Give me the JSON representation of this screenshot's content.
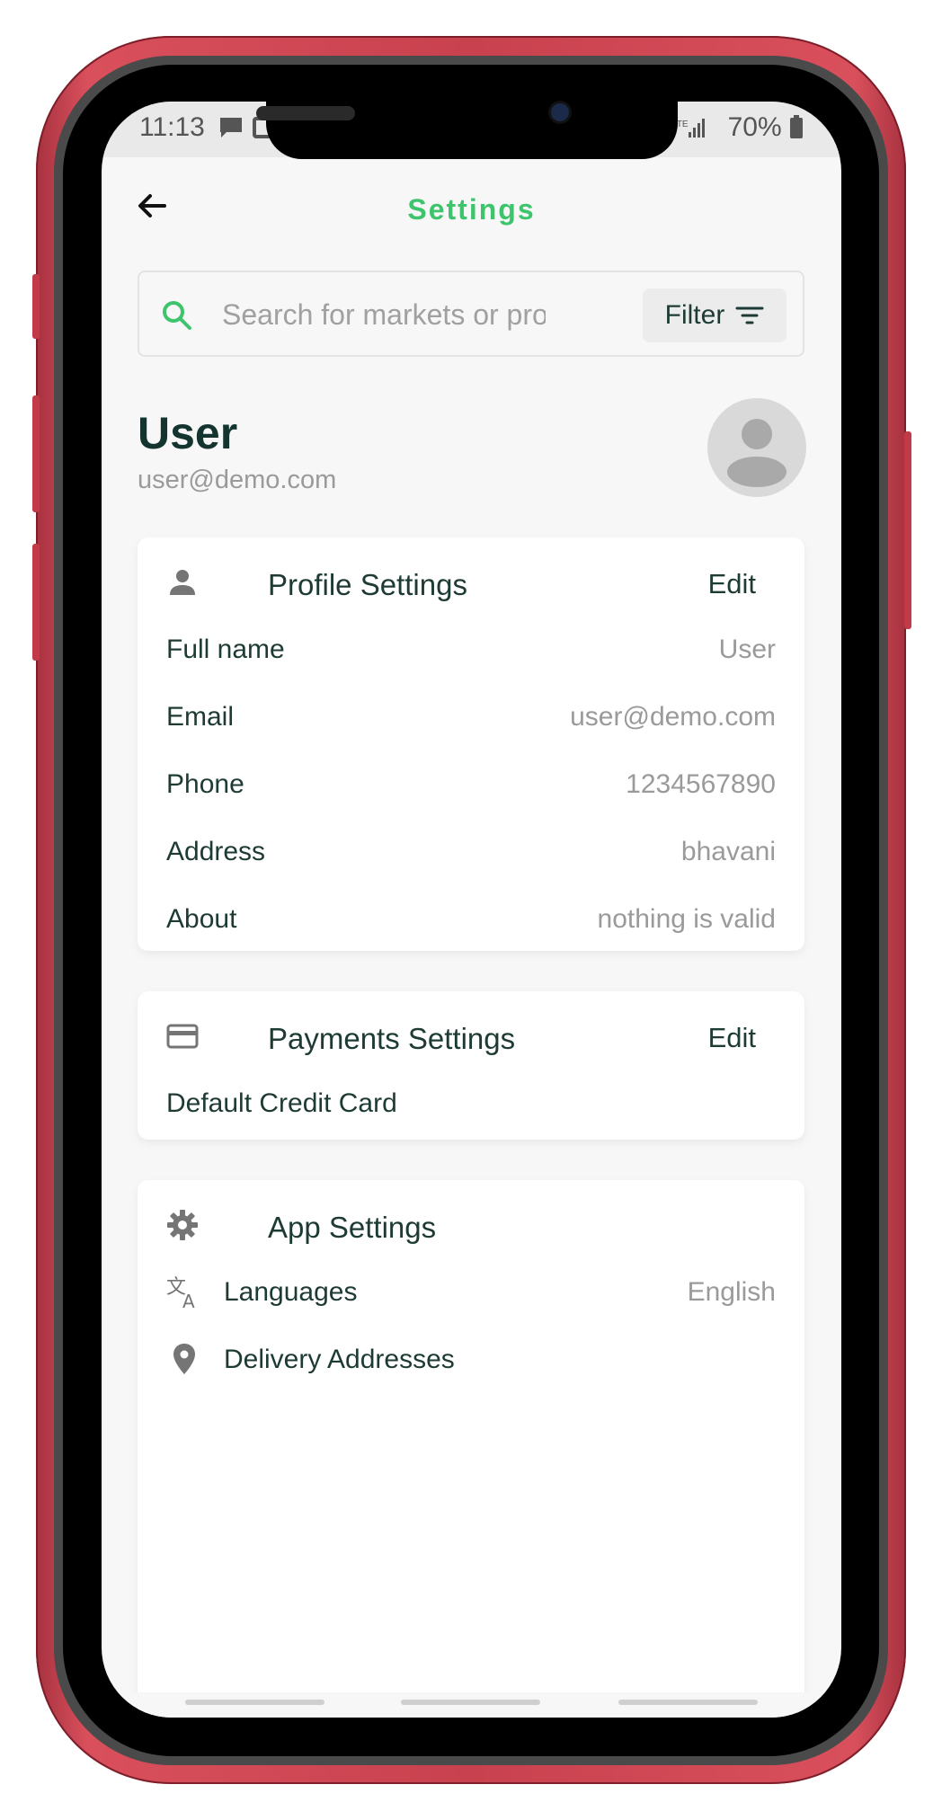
{
  "status_bar": {
    "time": "11:13",
    "battery": "70%"
  },
  "header": {
    "title": "Settings"
  },
  "search": {
    "placeholder": "Search for markets or products",
    "filter_label": "Filter"
  },
  "user": {
    "name": "User",
    "email": "user@demo.com"
  },
  "profile_settings": {
    "title": "Profile Settings",
    "edit_label": "Edit",
    "rows": [
      {
        "label": "Full name",
        "value": "User"
      },
      {
        "label": "Email",
        "value": "user@demo.com"
      },
      {
        "label": "Phone",
        "value": "1234567890"
      },
      {
        "label": "Address",
        "value": "bhavani"
      },
      {
        "label": "About",
        "value": "nothing is valid"
      }
    ]
  },
  "payments_settings": {
    "title": "Payments Settings",
    "edit_label": "Edit",
    "rows": [
      {
        "label": "Default Credit Card"
      }
    ]
  },
  "app_settings": {
    "title": "App Settings",
    "rows": [
      {
        "label": "Languages",
        "value": "English",
        "icon": "translate-icon"
      },
      {
        "label": "Delivery Addresses",
        "icon": "location-pin-icon"
      }
    ]
  },
  "colors": {
    "accent": "#3ec46d",
    "text_dark": "#1d3b34",
    "muted": "#9a9a9a",
    "frame": "#c8414e"
  }
}
